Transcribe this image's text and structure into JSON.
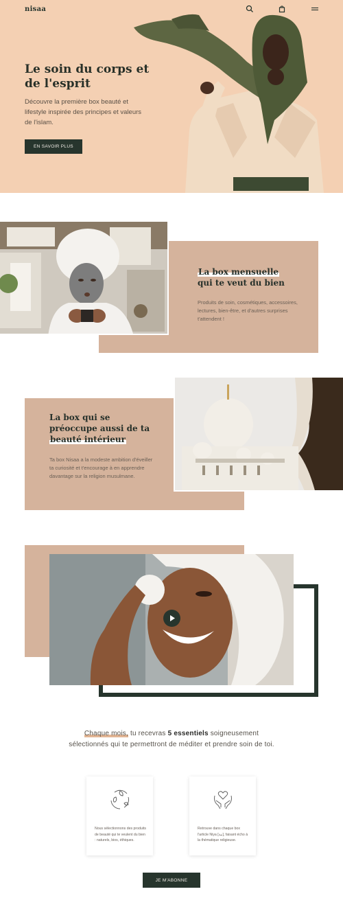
{
  "header": {
    "logo": "nisaa",
    "icons": [
      "search-icon",
      "bag-icon",
      "menu-icon"
    ]
  },
  "hero": {
    "title": "Le soin du corps et de l'esprit",
    "subtitle": "Découvre la première box beauté et lifestyle inspirée des principes et valeurs de l'islam.",
    "cta": "EN SAVOIR PLUS"
  },
  "section_monthly": {
    "title_line1": "La box mensuelle",
    "title_line2": "qui te veut du bien",
    "text": "Produits de soin, cosmétiques, accessoires, lectures, bien-être, et d'autres surprises t'attendent !"
  },
  "section_inner": {
    "title_line1": "La box qui se",
    "title_line2": "préoccupe aussi de ta",
    "title_line3": "beauté intérieur",
    "text": "Ta box Nisaa a la modeste ambition d'éveiller ta curiosité et t'encourage à en apprendre davantage sur la religion musulmane."
  },
  "video": {
    "play_icon": "play-icon"
  },
  "intro": {
    "part1": "Chaque mois,",
    "part2": " tu recevras ",
    "part3": "5 essentiels",
    "part4": " soigneusement sélectionnés qui te permettront de méditer et prendre soin de toi."
  },
  "features": [
    {
      "icon": "leaf-recycle-icon",
      "text": "Nous sélectionnons des produits de beauté qui te veulent du bien : naturels, bios, éthiques."
    },
    {
      "icon": "heart-hands-icon",
      "text": "Retrouve dans chaque box l'article Niya [نية], faisant écho à la thématique religieuse."
    }
  ],
  "subscribe": {
    "cta": "JE M'ABONNE"
  },
  "colors": {
    "peach": "#f4d0b3",
    "tan": "#d5b39c",
    "dark_green": "#27352d"
  }
}
